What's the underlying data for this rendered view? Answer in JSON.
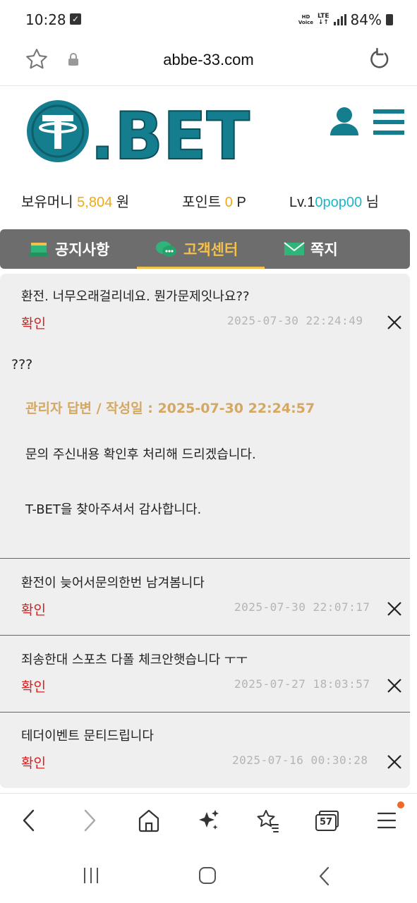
{
  "status_bar": {
    "time": "10:28",
    "hd_label_top": "HD",
    "hd_label_bottom": "Voice",
    "lte_label": "LTE",
    "battery": "84%"
  },
  "url_bar": {
    "url": "abbe-33.com"
  },
  "site": {
    "logo_text": ".BET",
    "brand_color": "#147d8e",
    "accent_color": "#f2c04b"
  },
  "wallet": {
    "money_label": "보유머니",
    "money_value": "5,804",
    "money_unit": "원",
    "point_label": "포인트",
    "point_value": "0",
    "point_unit": "P",
    "level_prefix": "Lv.1",
    "username": "0pop00",
    "honorific": "님"
  },
  "tabs": [
    {
      "label": "공지사항",
      "icon": "notice-icon"
    },
    {
      "label": "고객센터",
      "icon": "chat-bubble-icon"
    },
    {
      "label": "쪽지",
      "icon": "envelope-icon"
    }
  ],
  "inquiries": [
    {
      "title": "환전. 너무오래걸리네요. 뭔가문제잇나요??",
      "status": "확인",
      "date": "2025-07-30 22:24:49",
      "body": "???",
      "admin_reply": {
        "header": "관리자 답변 / 작성일 : 2025-07-30 22:24:57",
        "line1": "문의 주신내용 확인후 처리해 드리겠습니다.",
        "line2": "T-BET을 찾아주셔서 감사합니다."
      }
    },
    {
      "title": "환전이 늦어서문의한번 남겨봄니다",
      "status": "확인",
      "date": "2025-07-30 22:07:17"
    },
    {
      "title": "죄송한대 스포츠 다폴 체크안햇습니다 ㅜㅜ",
      "status": "확인",
      "date": "2025-07-27 18:03:57"
    },
    {
      "title": "테더이벤트 문티드립니다",
      "status": "확인",
      "date": "2025-07-16 00:30:28"
    }
  ],
  "browser_toolbar": {
    "tab_count": "57"
  }
}
